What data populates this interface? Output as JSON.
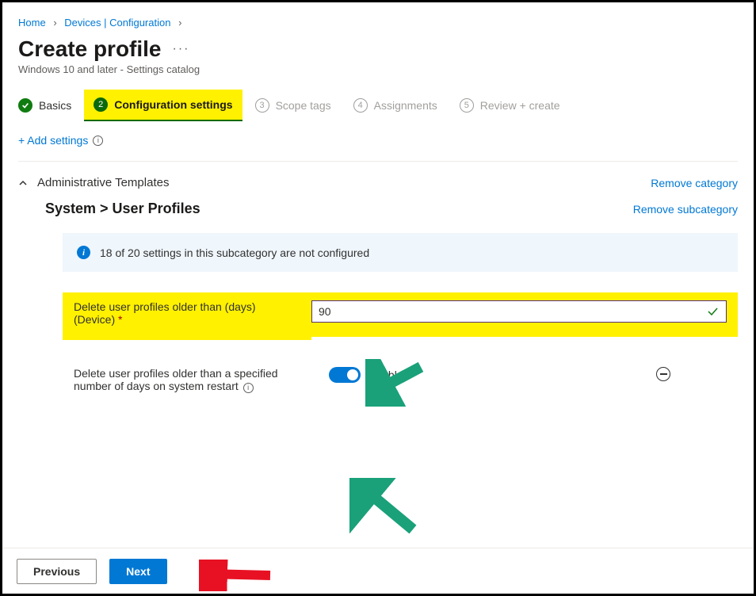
{
  "breadcrumb": {
    "home": "Home",
    "devices": "Devices | Configuration"
  },
  "header": {
    "title": "Create profile",
    "subtitle": "Windows 10 and later - Settings catalog"
  },
  "wizard": {
    "steps": [
      {
        "num": "",
        "label": "Basics"
      },
      {
        "num": "2",
        "label": "Configuration settings"
      },
      {
        "num": "3",
        "label": "Scope tags"
      },
      {
        "num": "4",
        "label": "Assignments"
      },
      {
        "num": "5",
        "label": "Review + create"
      }
    ]
  },
  "links": {
    "add_settings": "+ Add settings",
    "remove_category": "Remove category",
    "remove_subcategory": "Remove subcategory"
  },
  "category": {
    "name": "Administrative Templates",
    "subcategory": "System > User Profiles"
  },
  "banner": {
    "text": "18 of 20 settings in this subcategory are not configured"
  },
  "settings": {
    "days": {
      "label": "Delete user profiles older than (days) (Device)",
      "value": "90"
    },
    "toggle": {
      "label": "Delete user profiles older than a specified number of days on system restart",
      "state": "Enabled"
    }
  },
  "footer": {
    "previous": "Previous",
    "next": "Next"
  }
}
